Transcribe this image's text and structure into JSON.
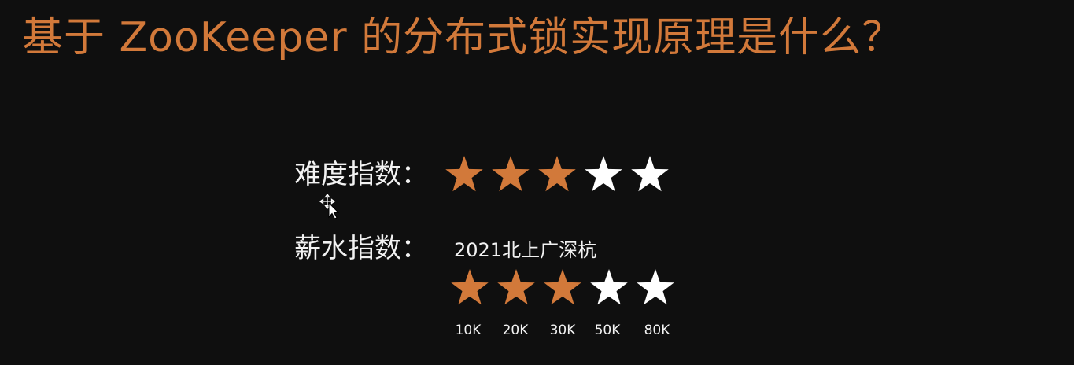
{
  "title": "基于 ZooKeeper 的分布式锁实现原理是什么？",
  "colors": {
    "accent": "#d2793a",
    "text": "#f2f2f2",
    "star_empty": "#ffffff",
    "background": "#0f0f0f"
  },
  "difficulty": {
    "label": "难度指数：",
    "rating": 3,
    "max": 5
  },
  "salary": {
    "label": "薪水指数：",
    "subtitle": "2021北上广深杭",
    "rating": 3,
    "max": 5,
    "levels": [
      "10K",
      "20K",
      "30K",
      "50K",
      "80K"
    ]
  },
  "cursor": {
    "icon": "move-cursor-icon"
  }
}
